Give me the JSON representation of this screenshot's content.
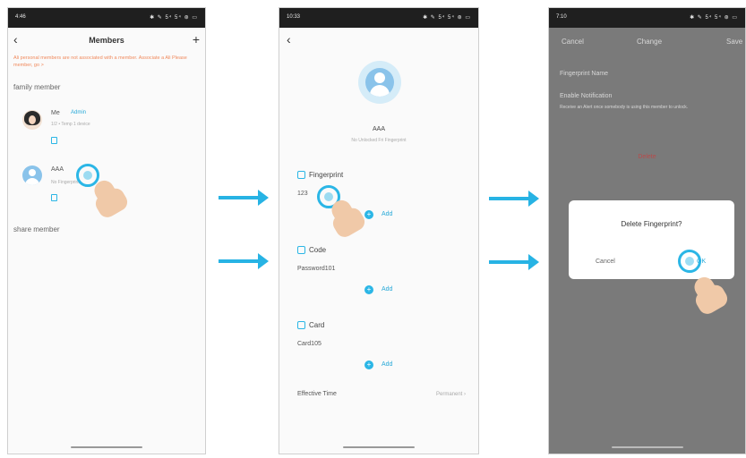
{
  "status_bar": {
    "screen1_time": "4:46",
    "screen2_time": "10:33",
    "screen3_time": "7:10",
    "icons_text": "✱ ✎ 5⁴ 5⁴ ⊛ ▭"
  },
  "screen1": {
    "title": "Members",
    "back": "‹",
    "add": "+",
    "notice": "Ali personal members are not associated with a member. Associate a Ali Please member, go >",
    "family_header": "family member",
    "members": [
      {
        "name": "Me",
        "role": "Admin",
        "detail": "1/2 • Temp 1 device"
      },
      {
        "name": "AAA",
        "role": "",
        "detail": "No Fingerprint"
      }
    ],
    "share_header": "share member"
  },
  "screen2": {
    "back": "‹",
    "name": "AAA",
    "subtitle": "No Unlocked Fri Fingerprint",
    "sections": [
      {
        "title": "Fingerprint",
        "item": "123",
        "add": "Add"
      },
      {
        "title": "Code",
        "item": "Password101",
        "add": "Add"
      },
      {
        "title": "Card",
        "item": "Card105",
        "add": "Add"
      }
    ],
    "effective_label": "Effective Time",
    "effective_value": "Permanent ›"
  },
  "screen3": {
    "cancel": "Cancel",
    "title": "Change",
    "save": "Save",
    "row1": "Fingerprint Name",
    "row2": "Enable Notification",
    "row2_sub": "Receive an Alert once somebody is using this member to unlock.",
    "delete": "Delete",
    "dialog_title": "Delete Fingerprint?",
    "dialog_cancel": "Cancel",
    "dialog_ok": "OK"
  },
  "colors": {
    "accent": "#27b3e4",
    "notice": "#f08a5d"
  },
  "icons": [
    "back-icon",
    "plus-icon",
    "avatar-icon",
    "tap-icon",
    "finger-icon",
    "arrow-icon"
  ]
}
